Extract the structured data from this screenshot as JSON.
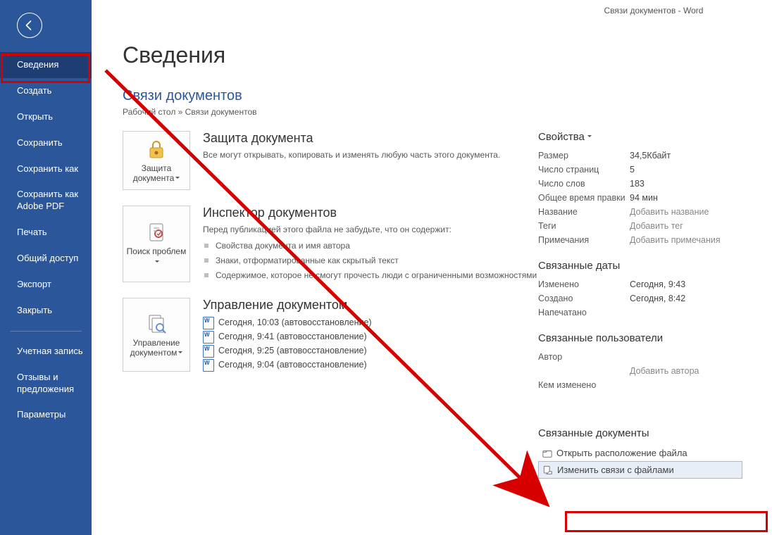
{
  "titlebar": "Связи документов  -  Word",
  "sidebar": {
    "items_top": [
      "Сведения",
      "Создать",
      "Открыть",
      "Сохранить",
      "Сохранить как",
      "Сохранить как Adobe PDF",
      "Печать",
      "Общий доступ",
      "Экспорт",
      "Закрыть"
    ],
    "items_bottom": [
      "Учетная запись",
      "Отзывы и предложения",
      "Параметры"
    ]
  },
  "page_title": "Сведения",
  "doc_title": "Связи документов",
  "breadcrumb": "Рабочий стол » Связи документов",
  "protect": {
    "button_label": "Защита документа",
    "title": "Защита документа",
    "desc": "Все могут открывать, копировать и изменять любую часть этого документа."
  },
  "inspect": {
    "button_label": "Поиск проблем",
    "title": "Инспектор документов",
    "desc": "Перед публикацией этого файла не забудьте, что он содержит:",
    "bullets": [
      "Свойства документа и имя автора",
      "Знаки, отформатированные как скрытый текст",
      "Содержимое, которое не смогут прочесть люди с ограниченными возможностями"
    ]
  },
  "manage": {
    "button_label": "Управление документом",
    "title": "Управление документом",
    "versions": [
      "Сегодня, 10:03 (автовосстановление)",
      "Сегодня, 9:41 (автовосстановление)",
      "Сегодня, 9:25 (автовосстановление)",
      "Сегодня, 9:04 (автовосстановление)"
    ]
  },
  "props": {
    "header": "Свойства",
    "rows": [
      {
        "k": "Размер",
        "v": "34,5Кбайт"
      },
      {
        "k": "Число страниц",
        "v": "5"
      },
      {
        "k": "Число слов",
        "v": "183"
      },
      {
        "k": "Общее время правки",
        "v": "94 мин"
      },
      {
        "k": "Название",
        "v": "Добавить название",
        "ph": true
      },
      {
        "k": "Теги",
        "v": "Добавить тег",
        "ph": true
      },
      {
        "k": "Примечания",
        "v": "Добавить примечания",
        "ph": true
      }
    ]
  },
  "dates": {
    "header": "Связанные даты",
    "rows": [
      {
        "k": "Изменено",
        "v": "Сегодня, 9:43"
      },
      {
        "k": "Создано",
        "v": "Сегодня, 8:42"
      },
      {
        "k": "Напечатано",
        "v": ""
      }
    ]
  },
  "users": {
    "header": "Связанные пользователи",
    "author_label": "Автор",
    "add_author": "Добавить автора",
    "modified_by_label": "Кем изменено"
  },
  "related_docs": {
    "header": "Связанные документы",
    "open_location": "Открыть расположение файла",
    "edit_links": "Изменить связи с файлами"
  }
}
